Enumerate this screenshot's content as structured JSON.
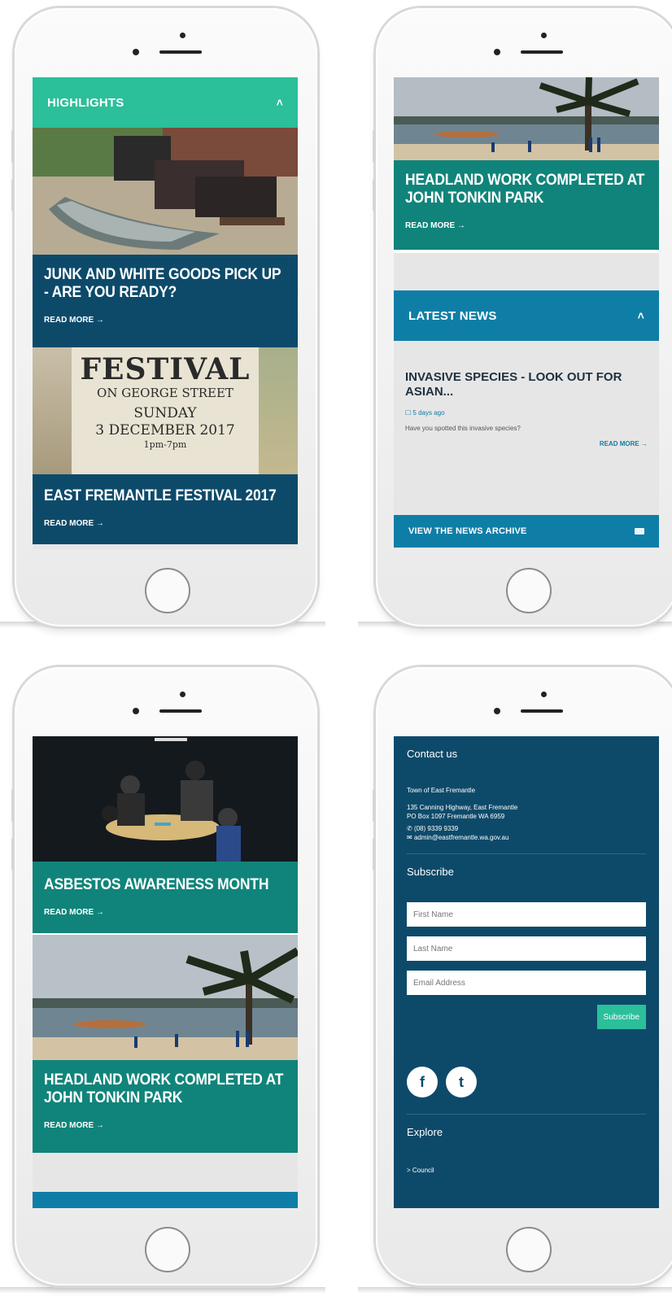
{
  "phone1": {
    "highlights_title": "HIGHLIGHTS",
    "card1_title": "JUNK AND WHITE GOODS PICK UP - ARE YOU READY?",
    "card1_link": "READ MORE →",
    "poster": {
      "line1": "FESTIVAL",
      "line2": "ON GEORGE STREET",
      "line3": "SUNDAY",
      "line4": "3 DECEMBER 2017",
      "line5": "1pm-7pm"
    },
    "card2_title": "EAST FREMANTLE FESTIVAL 2017",
    "card2_link": "READ MORE →"
  },
  "phone2": {
    "card_title": "HEADLAND WORK COMPLETED AT JOHN TONKIN PARK",
    "card_link": "READ MORE →",
    "latest_news_title": "LATEST NEWS",
    "news_title": "INVASIVE SPECIES - LOOK OUT FOR ASIAN...",
    "news_meta": "☐ 5 days ago",
    "news_desc": "Have you spotted this invasive species?",
    "news_more": "READ MORE →",
    "archive_label": "VIEW THE NEWS ARCHIVE"
  },
  "phone3": {
    "card1_title": "ASBESTOS AWARENESS MONTH",
    "card1_link": "READ MORE →",
    "card2_title": "HEADLAND WORK COMPLETED AT JOHN TONKIN PARK",
    "card2_link": "READ MORE →"
  },
  "phone4": {
    "contact_title": "Contact us",
    "org_name": "Town of East Fremantle",
    "address1": "135 Canning Highway, East Fremantle",
    "address2": "PO Box 1097 Fremantle WA 6959",
    "phone": "(08) 9339 9339",
    "email": "admin@eastfremantle.wa.gov.au",
    "subscribe_title": "Subscribe",
    "first_name_placeholder": "First Name",
    "last_name_placeholder": "Last Name",
    "email_placeholder": "Email Address",
    "subscribe_button": "Subscribe",
    "explore_title": "Explore",
    "explore_item": "> Council"
  },
  "colors": {
    "teal": "#2bbf9a",
    "blue": "#0f7ea6",
    "navy": "#0d4a6a",
    "green": "#10847a"
  }
}
